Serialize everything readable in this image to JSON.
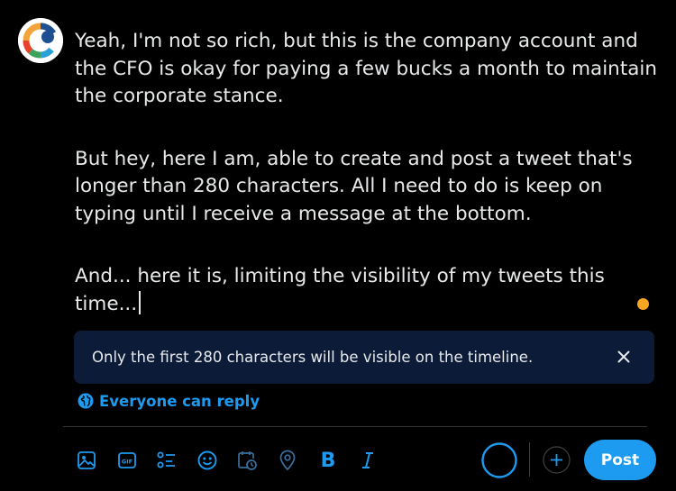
{
  "compose": {
    "paragraphs": [
      "Yeah, I'm not so rich, but this is the company account and the CFO is okay for paying a few bucks a month to maintain the corporate stance.",
      "But hey, here I am, able to create and post a tweet that's longer than 280 characters. All I need to do is keep on typing until I receive a message at the bottom.",
      "And... here it is, limiting the visibility of my tweets this time..."
    ]
  },
  "notice": {
    "text": "Only the first 280 characters will be visible on the timeline."
  },
  "reply_setting": {
    "label": "Everyone can reply"
  },
  "toolbar": {
    "icons": [
      "image-icon",
      "gif-icon",
      "poll-icon",
      "emoji-icon",
      "schedule-icon",
      "location-icon",
      "bold-icon",
      "italic-icon"
    ],
    "bold_label": "B",
    "gif_label": "GIF"
  },
  "post_button": {
    "label": "Post"
  },
  "colors": {
    "accent": "#1d9bf0",
    "warning_dot": "#f5a623",
    "notice_bg": "#0c1b38"
  }
}
